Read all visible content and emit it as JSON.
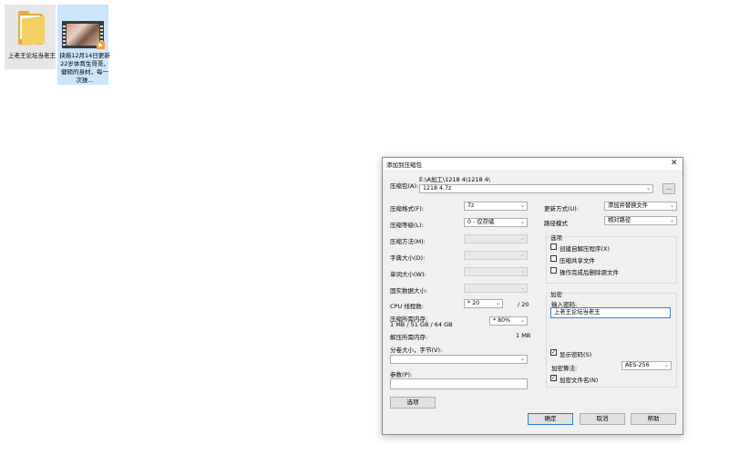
{
  "desktop": {
    "items": [
      {
        "label": "上老王论坛当老王",
        "icon": "folder-icon"
      },
      {
        "label": "抉摇12月14日更新22岁体育生哥哥，健硕的身材，每一次操...",
        "icon": "video-file-icon"
      }
    ]
  },
  "dialog": {
    "title": "添加到压缩包",
    "close": "✕",
    "archive": {
      "label": "压缩包(A):",
      "path": "E:\\A加工\\1218 4\\1218 4\\",
      "filename": "1218 4.7z",
      "browse": "..."
    },
    "left": {
      "format": {
        "label": "压缩格式(F):",
        "value": "7z"
      },
      "level": {
        "label": "压缩等级(L):",
        "value": "0 - 仅存储"
      },
      "method": {
        "label": "压缩方法(M):",
        "value": ""
      },
      "dict": {
        "label": "字典大小(D):",
        "value": ""
      },
      "word": {
        "label": "单词大小(W):",
        "value": ""
      },
      "solid": {
        "label": "固实数据大小:",
        "value": ""
      },
      "cpu": {
        "label": "CPU 线程数:",
        "value": "* 20",
        "total": "/ 20"
      },
      "mem_compress": {
        "label": "压缩所需内存:",
        "detail": "1 MB / 51 GB / 64 GB",
        "value": "* 80%"
      },
      "mem_decompress": {
        "label": "解压所需内存:",
        "value": "1 MB"
      },
      "split": {
        "label": "分卷大小，字节(V):",
        "value": ""
      },
      "params": {
        "label": "参数(P):",
        "value": ""
      },
      "options_button": "选项"
    },
    "right": {
      "update": {
        "label": "更新方式(U):",
        "value": "添加并替换文件"
      },
      "pathmode": {
        "label": "路径模式",
        "value": "相对路径"
      },
      "options": {
        "title": "选项",
        "items": [
          {
            "label": "创建自解压程序(X)",
            "checked": false
          },
          {
            "label": "压缩共享文件",
            "checked": false
          },
          {
            "label": "操作完成后删除源文件",
            "checked": false
          }
        ]
      },
      "encryption": {
        "title": "加密",
        "password_label": "输入密码:",
        "password_value": "上老王论坛当老王",
        "show_password": {
          "label": "显示密码(S)",
          "checked": true
        },
        "method_label": "加密算法:",
        "method_value": "AES-256",
        "encrypt_names": {
          "label": "加密文件名(N)",
          "checked": true
        }
      }
    },
    "buttons": {
      "ok": "确定",
      "cancel": "取消",
      "help": "帮助"
    }
  }
}
